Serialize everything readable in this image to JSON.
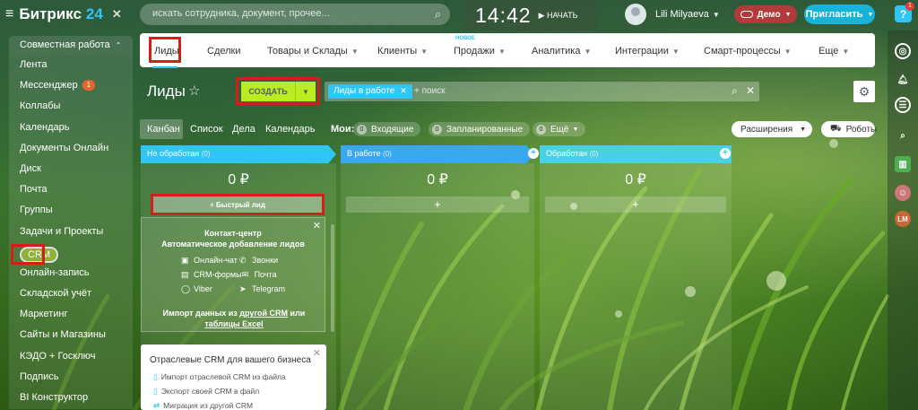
{
  "header": {
    "app_name": "Битрикс",
    "app_version": "24",
    "close_glyph": "✕",
    "search_placeholder": "искать сотрудника, документ, прочее...",
    "time": "14:42",
    "start_label": "НАЧАТЬ",
    "user_name": "Lili Milyaeva",
    "demo_label": "Демо",
    "invite_label": "Пригласить",
    "help_badge": "1"
  },
  "leftmenu": {
    "section_label": "Совместная работа",
    "items": [
      {
        "label": "Лента"
      },
      {
        "label": "Мессенджер",
        "badge": "1"
      },
      {
        "label": "Коллабы"
      },
      {
        "label": "Календарь"
      },
      {
        "label": "Документы Онлайн"
      },
      {
        "label": "Диск"
      },
      {
        "label": "Почта"
      },
      {
        "label": "Группы"
      },
      {
        "label": "Задачи и Проекты"
      },
      {
        "label": "CRM"
      },
      {
        "label": "Онлайн-запись"
      },
      {
        "label": "Складской учёт"
      },
      {
        "label": "Маркетинг"
      },
      {
        "label": "Сайты и Магазины"
      },
      {
        "label": "КЭДО + Госключ"
      },
      {
        "label": "Подпись"
      },
      {
        "label": "BI Конструктор"
      }
    ]
  },
  "topnav": {
    "items": [
      "Лиды",
      "Сделки",
      "Товары и Склады",
      "Клиенты",
      "Продажи",
      "Аналитика",
      "Интеграции",
      "Смарт-процессы",
      "Еще"
    ],
    "new_badge": "НОВОЕ"
  },
  "toolbar": {
    "title": "Лиды",
    "create_label": "СОЗДАТЬ",
    "filter_tag": "Лиды в работе",
    "filter_placeholder": "+ поиск"
  },
  "viewbar": {
    "views": [
      "Канбан",
      "Список",
      "Дела",
      "Календарь"
    ],
    "my_label": "Мои:",
    "incoming_count": "0",
    "incoming_label": "Входящие",
    "planned_count": "0",
    "planned_label": "Запланированные",
    "more_count": "0",
    "more_label": "Ещё",
    "extensions_label": "Расширения",
    "robots_label": "Роботы"
  },
  "kanban": {
    "columns": [
      {
        "name": "Не обработан",
        "count": "(0)",
        "sum": "0 ₽",
        "color": "#2fc6f6"
      },
      {
        "name": "В работе",
        "count": "(0)",
        "sum": "0 ₽",
        "color": "#39a8ef"
      },
      {
        "name": "Обработан",
        "count": "(0)",
        "sum": "0 ₽",
        "color": "#2fc6f6"
      }
    ],
    "quick_lead_label": "+ Быстрый лид",
    "add_glyph": "+"
  },
  "contact_center": {
    "title_line1": "Контакт-центр",
    "title_line2": "Автоматическое добавление лидов",
    "channels": [
      "Онлайн-чат",
      "Звонки",
      "CRM-формы",
      "Почта",
      "Viber",
      "Telegram"
    ],
    "import_text": "Импорт данных из ",
    "import_link1": "другой CRM",
    "import_or": " или",
    "import_link2": "таблицы Excel"
  },
  "industry": {
    "title": "Отраслевые CRM для вашего бизнеса",
    "lines": [
      "Импорт отраслевой CRM из файла",
      "Экспорт своей CRM в файл",
      "Миграция из другой CRM"
    ]
  },
  "colors": {
    "accent": "#2fc6f6",
    "create_button": "#bbed21",
    "demo": "#b33a3a",
    "highlight_box": "#d0201c"
  }
}
